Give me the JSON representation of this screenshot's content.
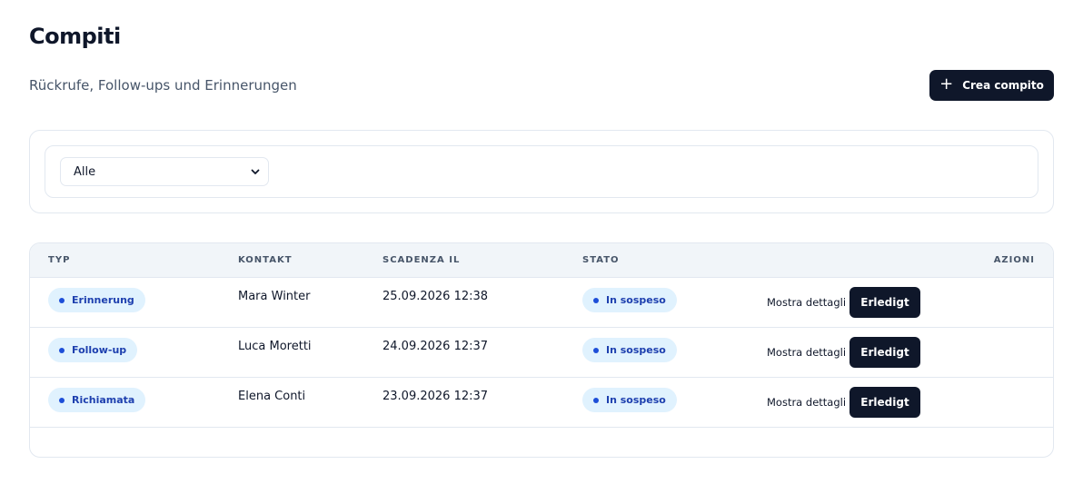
{
  "header": {
    "title": "Compiti",
    "subtitle": "Rückrufe, Follow-ups und Erinnerungen",
    "create_label": "Crea compito"
  },
  "filter": {
    "selected": "Alle"
  },
  "table": {
    "columns": {
      "type": "TYP",
      "contact": "KONTAKT",
      "due": "SCADENZA IL",
      "status": "STATO",
      "actions": "AZIONI"
    },
    "rows": [
      {
        "type": "Erinnerung",
        "contact": "Mara Winter",
        "due": "25.09.2026 12:38",
        "status": "In sospeso",
        "details_label": "Mostra dettagli",
        "done_label": "Erledigt"
      },
      {
        "type": "Follow-up",
        "contact": "Luca Moretti",
        "due": "24.09.2026 12:37",
        "status": "In sospeso",
        "details_label": "Mostra dettagli",
        "done_label": "Erledigt"
      },
      {
        "type": "Richiamata",
        "contact": "Elena Conti",
        "due": "23.09.2026 12:37",
        "status": "In sospeso",
        "details_label": "Mostra dettagli",
        "done_label": "Erledigt"
      }
    ]
  },
  "colors": {
    "primary": "#0f172a",
    "pill_bg": "#e0f2fe",
    "pill_text": "#1e40af"
  }
}
